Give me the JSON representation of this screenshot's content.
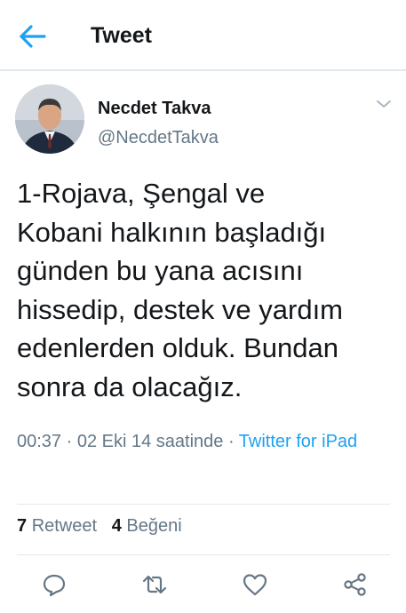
{
  "header": {
    "title": "Tweet",
    "back_icon": "arrow-left-icon"
  },
  "colors": {
    "accent": "#1da1f2",
    "text": "#14171a",
    "muted": "#657786",
    "divider": "#e1e8ed"
  },
  "tweet": {
    "author_name": "Necdet Takva",
    "author_handle": "@NecdetTakva",
    "text": "1-Rojava, Şengal ve\nKobani halkının başladığı\ngünden bu yana acısını\nhissedip, destek ve yardım\nedenlerden olduk. Bundan\nsonra da olacağız.",
    "timestamp": "00:37 · 02 Eki 14 saatinde · ",
    "source": "Twitter for iPad",
    "retweet_count": "7",
    "retweet_label": "Retweet",
    "like_count": "4",
    "like_label": "Beğeni"
  },
  "actions": [
    "reply-icon",
    "retweet-icon",
    "heart-icon",
    "share-icon"
  ]
}
